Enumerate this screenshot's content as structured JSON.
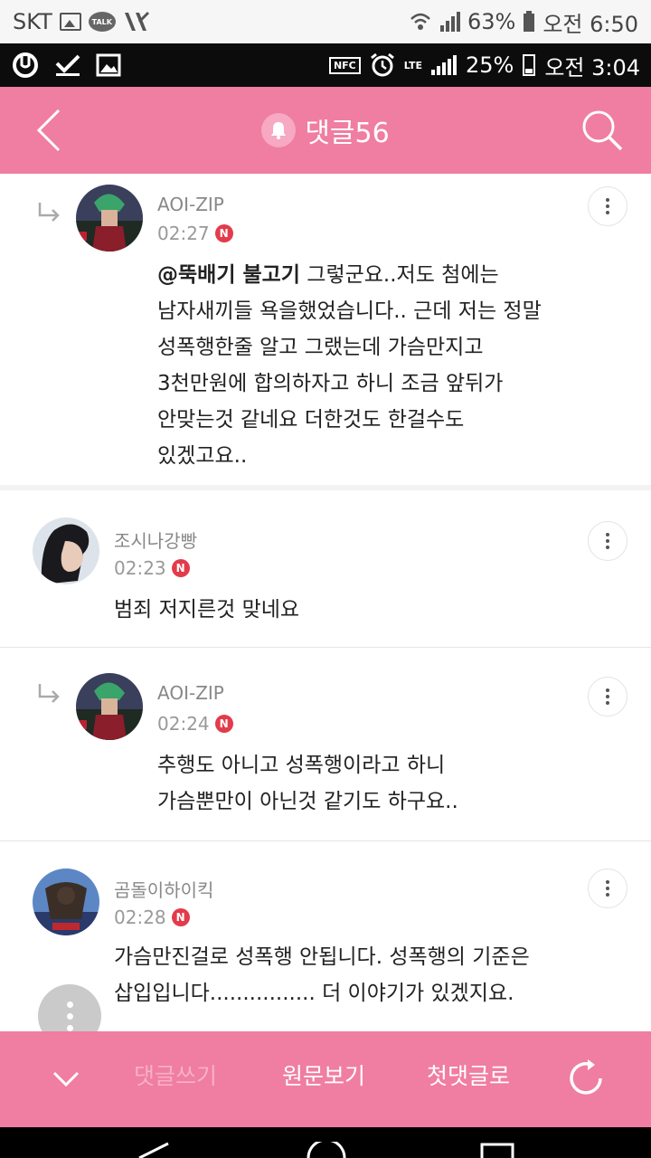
{
  "outer_status": {
    "carrier": "SKT",
    "talk_label": "TALK",
    "battery": "63%",
    "time": "오전 6:50"
  },
  "inner_status": {
    "nfc": "NFC",
    "lte": "LTE",
    "battery": "25%",
    "time": "오전 3:04"
  },
  "header": {
    "title": "댓글56"
  },
  "comments": [
    {
      "author": "AOI-ZIP",
      "time": "02:27",
      "badge": "N",
      "is_reply": true,
      "mention": "@뚝배기 불고기",
      "text": " 그렇군요..저도 첨에는\n남자새끼들 욕을했었습니다.. 근데 저는 정말\n성폭행한줄 알고 그랬는데 가슴만지고\n3천만원에 합의하자고 하니 조금 앞뒤가\n안맞는것 같네요 더한것도 한걸수도\n있겠고요.."
    },
    {
      "author": "조시나강빵",
      "time": "02:23",
      "badge": "N",
      "is_reply": false,
      "text": "범죄 저지른것 맞네요"
    },
    {
      "author": "AOI-ZIP",
      "time": "02:24",
      "badge": "N",
      "is_reply": true,
      "text": "추행도 아니고 성폭행이라고 하니\n가슴뿐만이 아닌것 같기도 하구요.."
    },
    {
      "author": "곰돌이하이킥",
      "time": "02:28",
      "badge": "N",
      "is_reply": false,
      "text": "가슴만진걸로 성폭행 안됩니다. 성폭행의 기준은\n삽입입니다................ 더 이야기가 있겠지요."
    }
  ],
  "bottom_bar": {
    "write": "댓글쓰기",
    "original": "원문보기",
    "first": "첫댓글로"
  },
  "colors": {
    "accent_pink": "#f07da2",
    "new_badge": "#e33b4b"
  }
}
